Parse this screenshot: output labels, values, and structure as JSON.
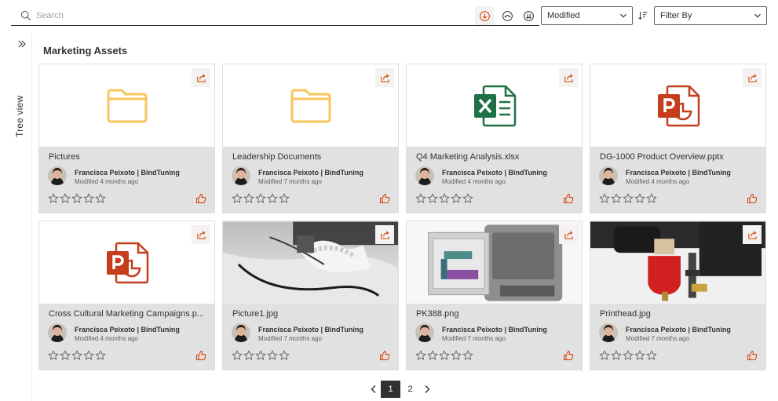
{
  "search": {
    "placeholder": "Search"
  },
  "toolbar": {
    "sort_value": "Modified",
    "filter_value": "Filter By"
  },
  "sidebar": {
    "label": "Tree view"
  },
  "section": {
    "title": "Marketing Assets"
  },
  "items": [
    {
      "name": "Pictures",
      "author": "Francisca Peixoto | BindTuning",
      "modified": "Modified 4 months ago",
      "kind": "folder-icon"
    },
    {
      "name": "Leadership Documents",
      "author": "Francisca Peixoto | BindTuning",
      "modified": "Modified 7 months ago",
      "kind": "folder-icon"
    },
    {
      "name": "Q4 Marketing Analysis.xlsx",
      "author": "Francisca Peixoto | BindTuning",
      "modified": "Modified 4 months ago",
      "kind": "excel-icon"
    },
    {
      "name": "DG-1000 Product Overview.pptx",
      "author": "Francisca Peixoto | BindTuning",
      "modified": "Modified 4 months ago",
      "kind": "powerpoint-icon"
    },
    {
      "name": "Cross Cultural Marketing Campaigns.p...",
      "author": "Francisca Peixoto | BindTuning",
      "modified": "Modified 4 months ago",
      "kind": "powerpoint-icon"
    },
    {
      "name": "Picture1.jpg",
      "author": "Francisca Peixoto | BindTuning",
      "modified": "Modified 7 months ago",
      "kind": "image-thumbnail"
    },
    {
      "name": "PK388.png",
      "author": "Francisca Peixoto | BindTuning",
      "modified": "Modified 7 months ago",
      "kind": "image-thumbnail"
    },
    {
      "name": "Printhead.jpg",
      "author": "Francisca Peixoto | BindTuning",
      "modified": "Modified 7 months ago",
      "kind": "image-thumbnail"
    }
  ],
  "pagination": {
    "pages": [
      "1",
      "2"
    ],
    "current": "1"
  },
  "colors": {
    "accent": "#d83b01",
    "folder": "#f8c45c",
    "excel": "#1e7145",
    "powerpoint": "#c43e1c",
    "card_meta_bg": "#e1e1e1"
  }
}
